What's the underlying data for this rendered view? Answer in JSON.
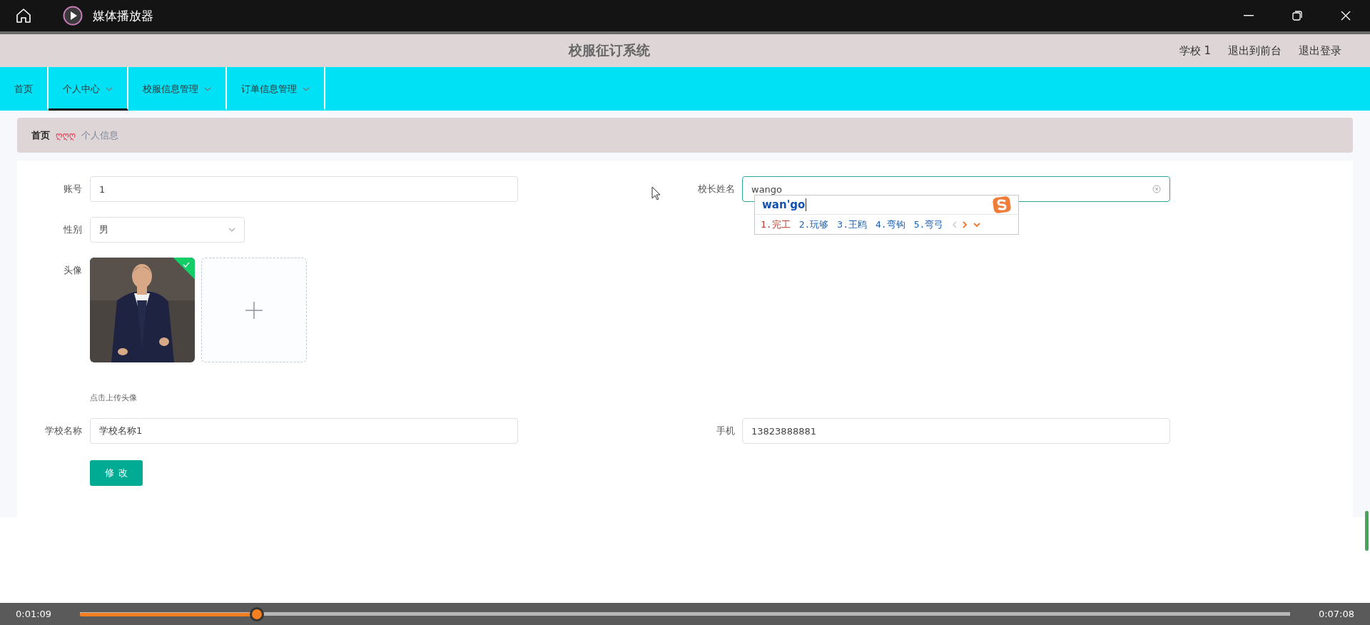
{
  "player": {
    "title": "媒体播放器",
    "current_time": "0:01:09",
    "total_time": "0:07:08",
    "level": 0.146
  },
  "header": {
    "title": "校服征订系统",
    "links": [
      "学校 1",
      "退出到前台",
      "退出登录"
    ]
  },
  "nav": [
    {
      "label": "首页",
      "selected": false,
      "dropdown": false
    },
    {
      "label": "个人中心",
      "selected": true,
      "dropdown": true
    },
    {
      "label": "校服信息管理",
      "selected": false,
      "dropdown": true
    },
    {
      "label": "订单信息管理",
      "selected": false,
      "dropdown": true
    }
  ],
  "breadcrumb": {
    "items": [
      "首页",
      "个人信息"
    ],
    "separator": "ღღღ"
  },
  "form": {
    "rows": [
      {
        "fields": [
          {
            "kind": "text",
            "label": "账号",
            "value": "1",
            "focused": false
          },
          {
            "kind": "text",
            "label": "校长姓名",
            "value": "wango",
            "focused": true
          }
        ]
      },
      {
        "fields": [
          {
            "kind": "select",
            "label": "性别",
            "value": "男"
          }
        ]
      },
      {
        "fields": [
          {
            "kind": "upload",
            "label": "头像",
            "uploaded": true,
            "hint": "点击上传头像"
          }
        ]
      },
      {
        "fields": [
          {
            "kind": "text",
            "label": "学校名称",
            "value": "学校名称1",
            "focused": false
          },
          {
            "kind": "text",
            "label": "手机",
            "value": "13823888881",
            "focused": false
          }
        ]
      }
    ],
    "submit": "修改"
  },
  "ime": {
    "composition": "wan'go",
    "candidates": [
      {
        "text": "1.完工",
        "selected": true
      },
      {
        "text": "2.玩够",
        "selected": false
      },
      {
        "text": "3.王鸥",
        "selected": false
      },
      {
        "text": "4.弯钩",
        "selected": false
      },
      {
        "text": "5.弯弓",
        "selected": false
      }
    ]
  }
}
